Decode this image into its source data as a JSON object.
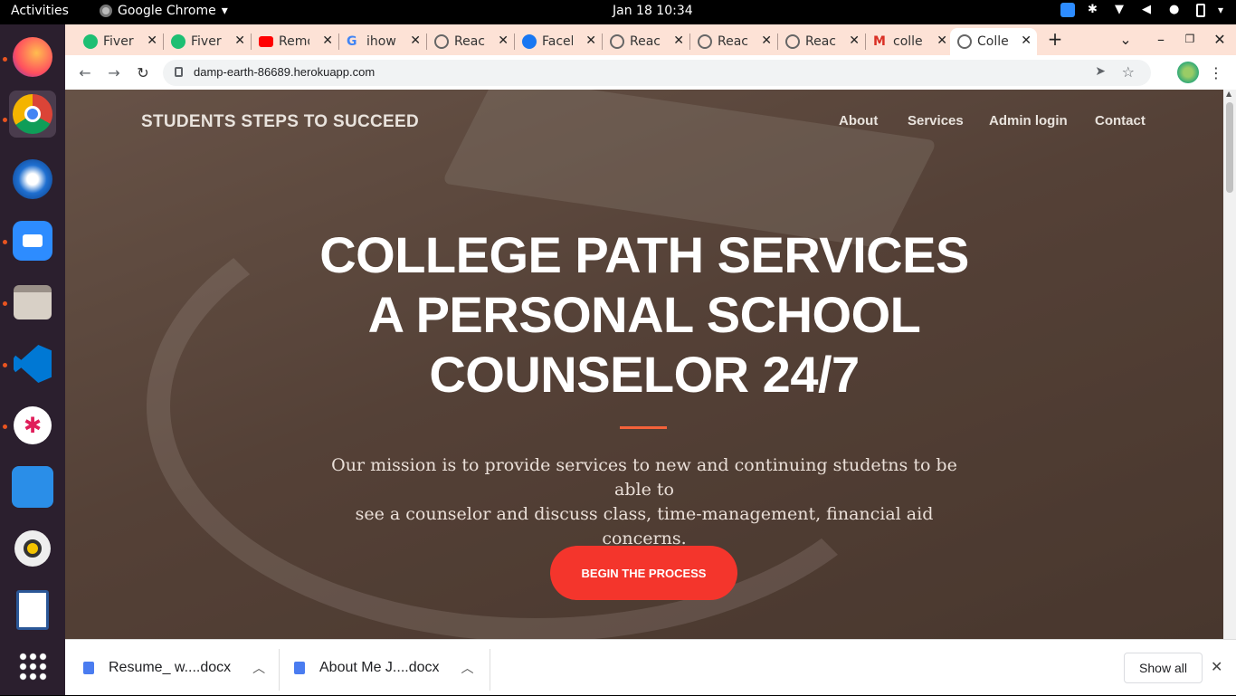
{
  "topbar": {
    "activities": "Activities",
    "app_name": "Google Chrome",
    "clock": "Jan 18  10:34"
  },
  "tabs": [
    {
      "label": "Fiver",
      "favicon": "fiverr-icon"
    },
    {
      "label": "Fiver",
      "favicon": "fiverr-icon"
    },
    {
      "label": "Remo",
      "favicon": "youtube-icon"
    },
    {
      "label": "ihow",
      "favicon": "google-icon"
    },
    {
      "label": "Reac",
      "favicon": "globe-icon"
    },
    {
      "label": "Faceb",
      "favicon": "facebook-icon"
    },
    {
      "label": "Reac",
      "favicon": "globe-icon"
    },
    {
      "label": "Reac",
      "favicon": "globe-icon"
    },
    {
      "label": "Reac",
      "favicon": "globe-icon"
    },
    {
      "label": "colle",
      "favicon": "gmail-icon"
    },
    {
      "label": "Colle",
      "favicon": "globe-icon"
    }
  ],
  "omnibox": {
    "url": "damp-earth-86689.herokuapp.com"
  },
  "site": {
    "brand": "STUDENTS STEPS TO SUCCEED",
    "nav": [
      "About",
      "Services",
      "Admin login",
      "Contact"
    ],
    "headline_l1": "COLLEGE PATH SERVICES",
    "headline_l2": "A PERSONAL SCHOOL",
    "headline_l3": "COUNSELOR 24/7",
    "mission_l1": "Our mission is to provide services to new and continuing studetns to be able to",
    "mission_l2": "see a counselor and discuss class, time-management, financial aid concerns.",
    "cta": "BEGIN THE PROCESS",
    "accent_color": "#f4352c"
  },
  "downloads": {
    "items": [
      "Resume_ w....docx",
      "About Me J....docx"
    ],
    "show_all": "Show all"
  }
}
